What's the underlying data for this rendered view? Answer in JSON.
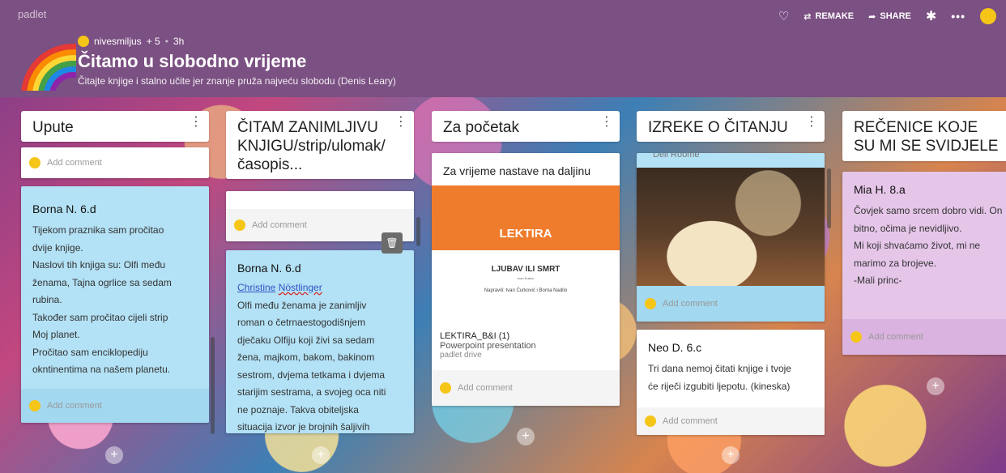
{
  "brand": "padlet",
  "toolbar": {
    "remake_label": "REMAKE",
    "share_label": "SHARE",
    "more_label": "•••"
  },
  "board": {
    "author": "nivesmiljus",
    "contributors": "+ 5",
    "separator": "•",
    "time": "3h",
    "title": "Čitamo u slobodno vrijeme",
    "subtitle": "Čitajte knjige i stalno učite jer znanje pruža najveću slobodu (Denis Leary)"
  },
  "comment_placeholder": "Add comment",
  "columns": [
    {
      "title": "Upute",
      "cards": [
        {
          "author": "Borna N. 6.d",
          "lines": [
            " Tijekom praznika sam pročitao",
            "dvije knjige.",
            "Naslovi tih knjiga su: Olfi među",
            "ženama, Tajna ogrlice sa sedam",
            "rubina.",
            "Također sam pročitao cijeli strip",
            "Moj planet.",
            "Pročitao sam enciklopediju",
            "okntinentima na našem planetu."
          ]
        }
      ]
    },
    {
      "title": "ČITAM ZANIMLJIVU KNJIGU/strip/ulomak/časopis...",
      "cards": [
        {
          "author": "Borna N.",
          "author_suffix": "6.d",
          "link_first": "Christine",
          "link_last": "Nöstlinger",
          "lines": [
            "Olfi među ženama je zanimljiv",
            "roman o četrnaestogodišnjem",
            "dječaku Olfiju koji živi sa sedam",
            "žena, majkom, bakom, bakinom",
            "sestrom, dvjema tetkama i dvjema",
            "starijim sestrama, a svojeg oca niti",
            "ne poznaje. Takva obiteljska",
            "situacija izvor je brojnih šaljivih"
          ]
        }
      ]
    },
    {
      "title": "Za početak",
      "cards": [
        {
          "heading": "Za vrijeme nastave na daljinu",
          "banner": "LEKTIRA",
          "slide_title": "LJUBAV ILI SMRT",
          "slide_sub": "Ivan Kušan",
          "slide_authors": "Napravili: Ivan Ćurković i Borna Nadilo",
          "file_name": "LEKTIRA_B&I (1)",
          "file_type": "Powerpoint presentation",
          "file_source": "padlet drive"
        }
      ]
    },
    {
      "title": "IZREKE O ČITANJU",
      "cards": [
        {
          "cut_text": "Deli Roome"
        },
        {
          "author": "Neo D. 6.c",
          "lines": [
            "Tri dana nemoj čitati knjige i tvoje",
            "će riječi izgubiti ljepotu. (kineska)"
          ]
        }
      ]
    },
    {
      "title": "REČENICE KOJE SU MI SE SVIDJELE",
      "cards": [
        {
          "author": "Mia H. 8.a",
          "lines": [
            "Čovjek samo srcem dobro vidi. On",
            "bitno, očima je nevidljivo.",
            "Mi koji shvaćamo život, mi ne",
            "marimo za brojeve.",
            "-Mali princ-"
          ]
        }
      ]
    }
  ],
  "plus_label": "+",
  "colors": {
    "header": "#7b5082",
    "card_blue": "#b3e1f5",
    "card_purple": "#e5c6e9",
    "lektira_orange": "#ef7c2d",
    "avatar_yellow": "#f5c518"
  },
  "icons": [
    "heart-icon",
    "remake-icon",
    "share-icon",
    "gear-icon",
    "more-icon",
    "trash-icon",
    "kebab-icon",
    "plus-icon",
    "avatar-icon",
    "rainbow-icon"
  ]
}
